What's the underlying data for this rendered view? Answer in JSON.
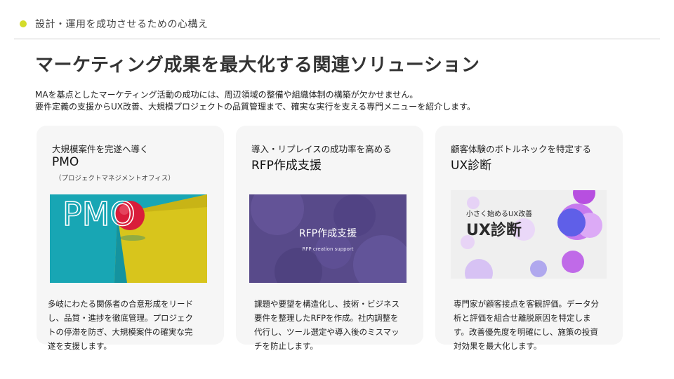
{
  "header": {
    "section_label": "設計・運用を成功させるための心構え",
    "title": "マーケティング成果を最大化する関連ソリューション",
    "lead_line1": "MAを基点としたマーケティング活動の成功には、周辺領域の整備や組織体制の構築が欠かせません。",
    "lead_line2": "要件定義の支援からUX改善、大規模プロジェクトの品質管理まで、確実な実行を支える専門メニューを紹介します。"
  },
  "cards": [
    {
      "tag": "大規模案件を完遂へ導く",
      "name": "PMO",
      "sub": "（プロジェクトマネジメントオフィス）",
      "image_text": "PMO",
      "desc_lines": [
        "多岐にわたる関係者の合意形成をリード",
        "し、品質・進捗を徹底管理。プロジェク",
        "トの停滞を防ぎ、大規模案件の確実な完",
        "遂を支援します。"
      ]
    },
    {
      "tag": "導入・リプレイスの成功率を高める",
      "name": "RFP作成支援",
      "image_title": "RFP作成支援",
      "image_subtitle": "RFP creation support",
      "desc_lines": [
        "課題や要望を構造化し、技術・ビジネス",
        "要件を整理したRFPを作成。社内調整を",
        "代行し、ツール選定や導入後のミスマッ",
        "チを防止します。"
      ]
    },
    {
      "tag": "顧客体験のボトルネックを特定する",
      "name": "UX診断",
      "image_small": "小さく始めるUX改善",
      "image_big": "UX診断",
      "desc_lines": [
        "専門家が顧客接点を客観評価。データ分",
        "析と評価を組合せ離脱原因を特定しま",
        "す。改善優先度を明確にし、施策の投資",
        "対効果を最大化します。"
      ]
    }
  ],
  "colors": {
    "accent_dot": "#d4dc2a",
    "card_bg": "#f6f6f6",
    "pmo_teal": "#1aa3b0",
    "pmo_yellow": "#d6c21a",
    "pmo_ball": "#d81e3a",
    "rfp_purple": "#5a4a8c",
    "ux_purple": "#b84ee0"
  }
}
